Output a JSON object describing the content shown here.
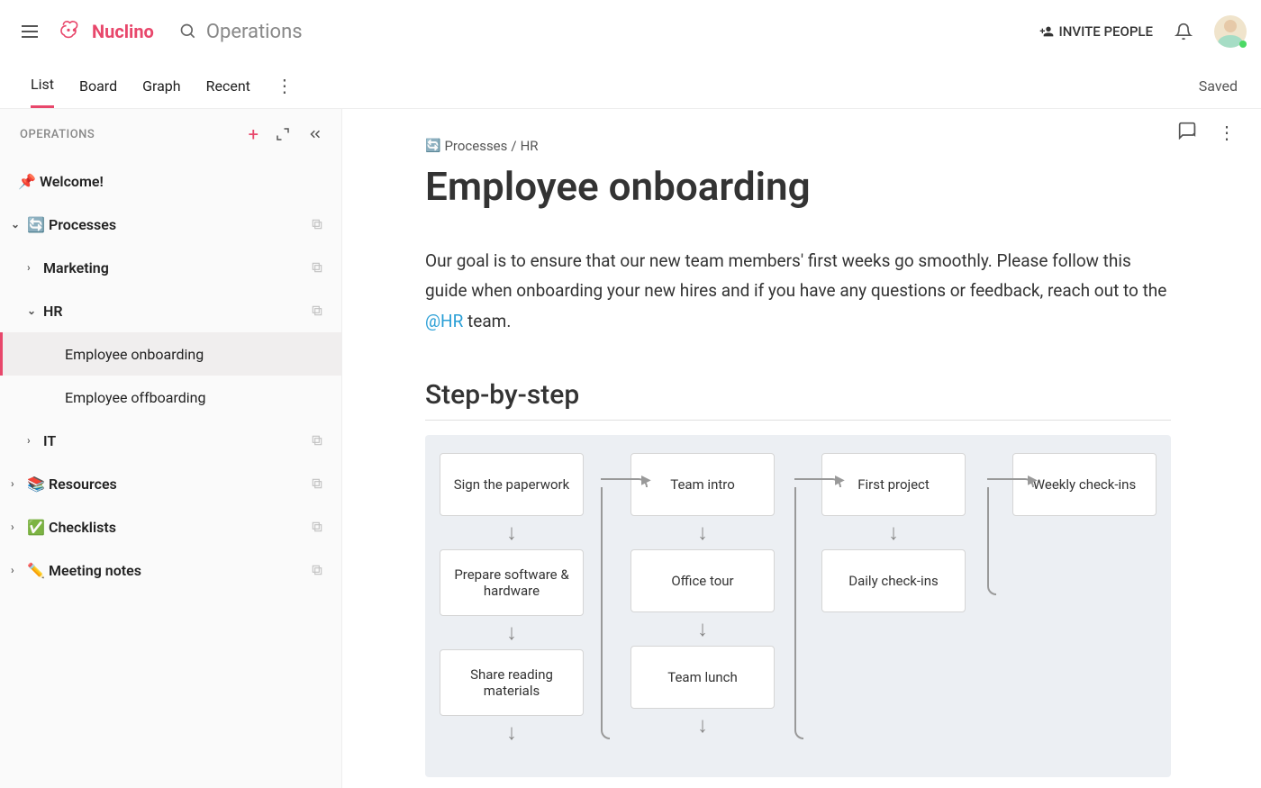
{
  "header": {
    "app_name": "Nuclino",
    "search_placeholder": "Operations",
    "invite_label": "INVITE PEOPLE"
  },
  "tabs": {
    "items": [
      "List",
      "Board",
      "Graph",
      "Recent"
    ],
    "active_index": 0,
    "saved_label": "Saved"
  },
  "sidebar": {
    "title": "OPERATIONS",
    "tree": [
      {
        "label": "Welcome!",
        "icon": "📌",
        "depth": 0,
        "expandable": false
      },
      {
        "label": "Processes",
        "icon": "🔄",
        "depth": 0,
        "expandable": true,
        "expanded": true
      },
      {
        "label": "Marketing",
        "depth": 1,
        "expandable": true,
        "expanded": false
      },
      {
        "label": "HR",
        "depth": 1,
        "expandable": true,
        "expanded": true
      },
      {
        "label": "Employee onboarding",
        "depth": 2,
        "selected": true
      },
      {
        "label": "Employee offboarding",
        "depth": 2
      },
      {
        "label": "IT",
        "depth": 1,
        "expandable": true,
        "expanded": false
      },
      {
        "label": "Resources",
        "icon": "📚",
        "depth": 0,
        "expandable": true,
        "expanded": false
      },
      {
        "label": "Checklists",
        "icon": "✅",
        "depth": 0,
        "expandable": true,
        "expanded": false
      },
      {
        "label": "Meeting notes",
        "icon": "✏️",
        "depth": 0,
        "expandable": true,
        "expanded": false
      }
    ]
  },
  "doc": {
    "breadcrumb_parts": [
      "Processes",
      "HR"
    ],
    "title": "Employee onboarding",
    "intro_before": "Our goal is to ensure that our new team members' first weeks go smoothly. Please follow this guide when onboarding your new hires and if you have any questions or feedback, reach out to the ",
    "mention": "@HR",
    "intro_after": " team.",
    "section_heading": "Step-by-step",
    "flowchart": {
      "columns": [
        [
          "Sign the paperwork",
          "Prepare software & hardware",
          "Share reading materials"
        ],
        [
          "Team intro",
          "Office tour",
          "Team lunch"
        ],
        [
          "First project",
          "Daily check-ins"
        ],
        [
          "Weekly check-ins"
        ]
      ]
    }
  }
}
